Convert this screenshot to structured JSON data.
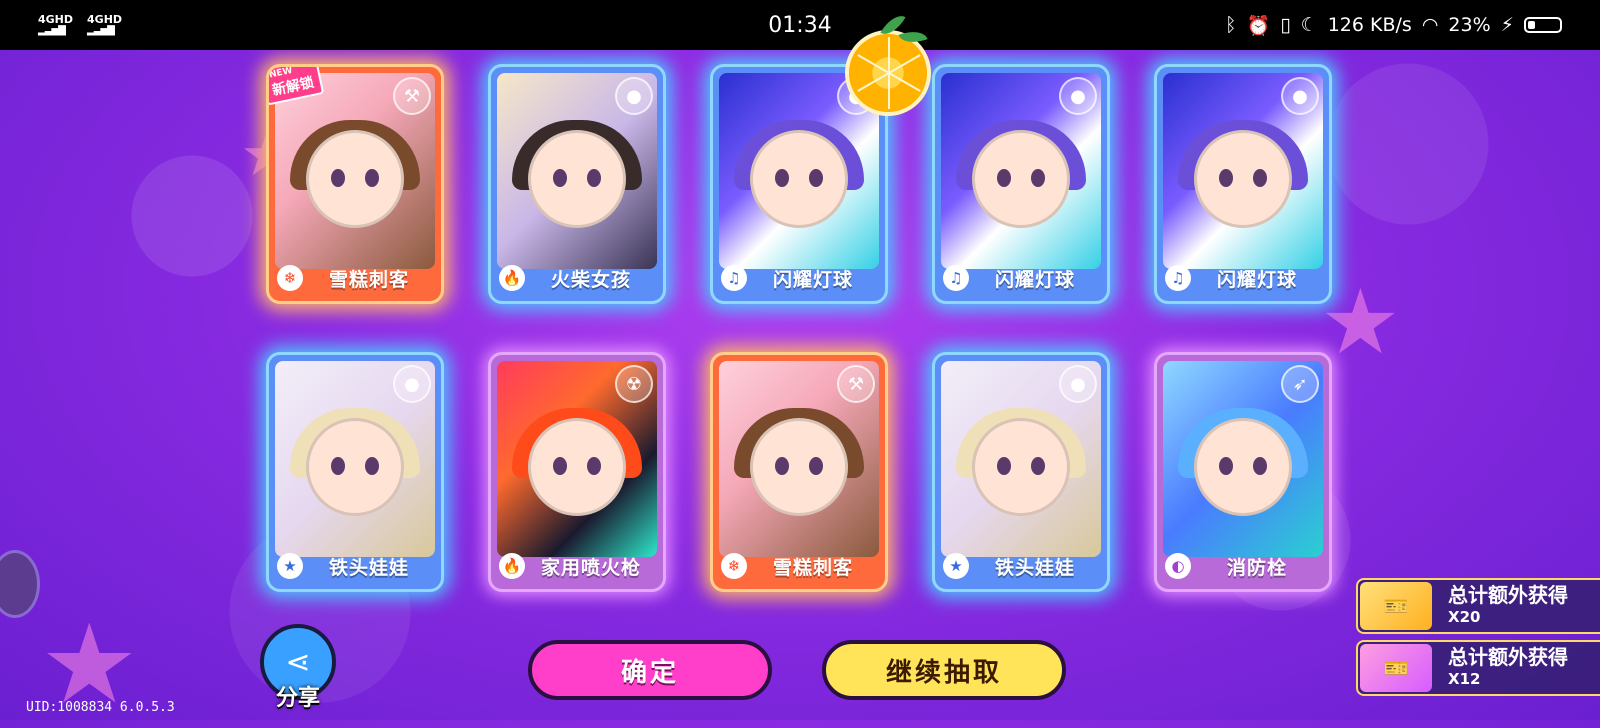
{
  "status_bar": {
    "signal_left": [
      "4GHD",
      "4GHD"
    ],
    "time": "01:34",
    "network_speed": "126 KB/s",
    "battery_percent": "23%",
    "battery_level": 0.23
  },
  "cards": [
    {
      "name": "雪糕刺客",
      "rarity": "orange",
      "attribute_icon": "snowflake-icon",
      "type_icon": "hammer-icon",
      "is_new": true,
      "new_label": "NEW",
      "new_text": "新解锁"
    },
    {
      "name": "火柴女孩",
      "rarity": "blue",
      "attribute_icon": "flame-icon",
      "type_icon": "bomb-icon",
      "is_new": false
    },
    {
      "name": "闪耀灯球",
      "rarity": "blue",
      "attribute_icon": "music-note-icon",
      "type_icon": "bomb-icon",
      "is_new": false
    },
    {
      "name": "闪耀灯球",
      "rarity": "blue",
      "attribute_icon": "music-note-icon",
      "type_icon": "bomb-icon",
      "is_new": false
    },
    {
      "name": "闪耀灯球",
      "rarity": "blue",
      "attribute_icon": "music-note-icon",
      "type_icon": "bomb-icon",
      "is_new": false
    },
    {
      "name": "铁头娃娃",
      "rarity": "blue",
      "attribute_icon": "star-icon",
      "type_icon": "bomb-icon",
      "is_new": false
    },
    {
      "name": "家用喷火枪",
      "rarity": "purple",
      "attribute_icon": "flame-icon",
      "type_icon": "radiation-icon",
      "is_new": false
    },
    {
      "name": "雪糕刺客",
      "rarity": "orange",
      "attribute_icon": "snowflake-icon",
      "type_icon": "hammer-icon",
      "is_new": false
    },
    {
      "name": "铁头娃娃",
      "rarity": "blue",
      "attribute_icon": "star-icon",
      "type_icon": "bomb-icon",
      "is_new": false
    },
    {
      "name": "消防栓",
      "rarity": "purple",
      "attribute_icon": "moon-icon",
      "type_icon": "bow-icon",
      "is_new": false
    }
  ],
  "buttons": {
    "share_label": "分享",
    "confirm_label": "确定",
    "continue_label": "继续抽取"
  },
  "rewards": [
    {
      "label": "总计额外获得",
      "count": "X20",
      "ticket": "gold"
    },
    {
      "label": "总计额外获得",
      "count": "X12",
      "ticket": "pink"
    }
  ],
  "footer": {
    "uid_text": "UID:1008834 6.0.5.3"
  },
  "colors": {
    "background": "#8a2be2",
    "card_blue": "#5b8ff7",
    "card_orange": "#ff6a3d",
    "card_purple": "#b86ad8",
    "confirm_button": "#ff3ec9",
    "continue_button": "#ffe45a"
  }
}
